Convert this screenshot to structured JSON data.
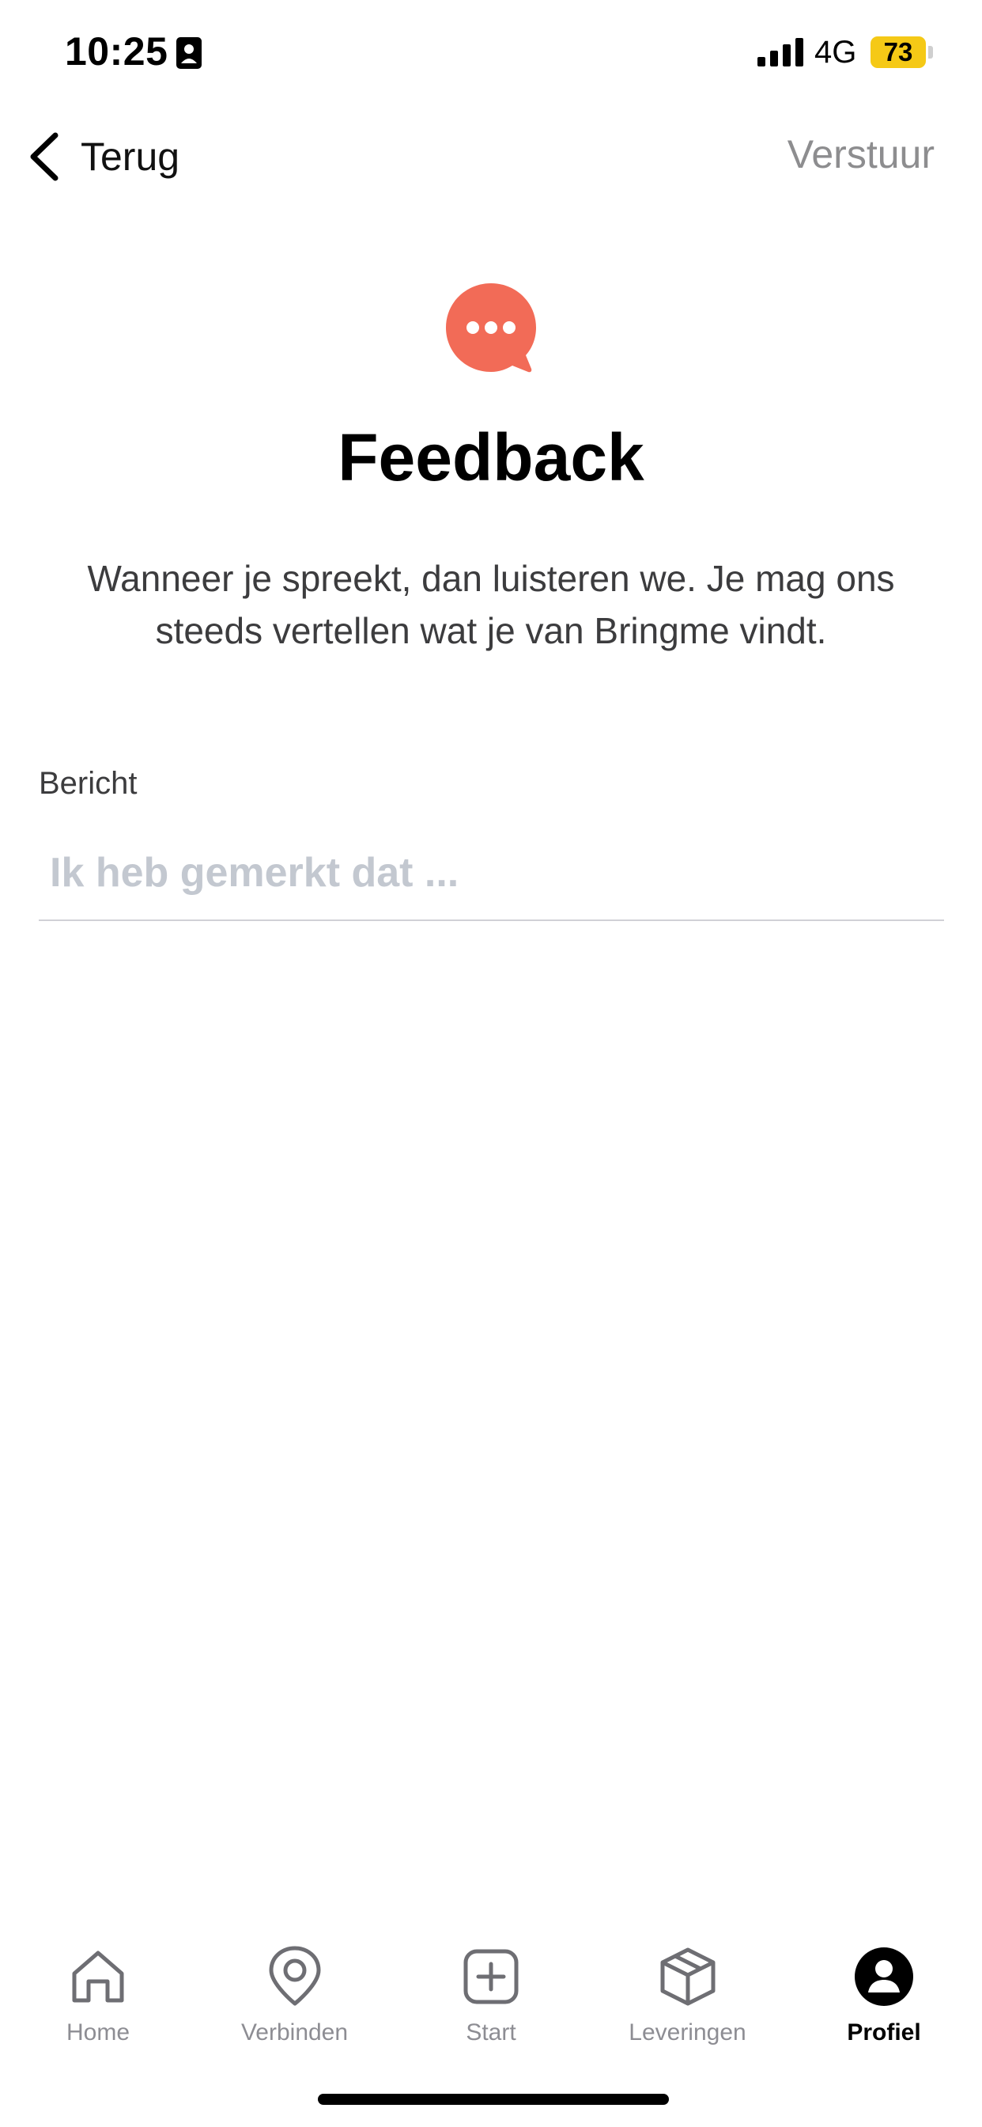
{
  "status_bar": {
    "time": "10:25",
    "network": "4G",
    "battery_level": "73",
    "battery_color": "#f5c916"
  },
  "nav": {
    "back_label": "Terug",
    "send_label": "Verstuur"
  },
  "header": {
    "icon": "chat-bubble-icon",
    "icon_color": "#f26b57",
    "title": "Feedback",
    "subtitle": "Wanneer je spreekt, dan luisteren we. Je mag ons steeds vertellen wat je van Bringme vindt."
  },
  "form": {
    "message_label": "Bericht",
    "message_value": "",
    "message_placeholder": "Ik heb gemerkt dat ..."
  },
  "tab_bar": {
    "active_tab": "Profiel",
    "tabs": [
      {
        "label": "Home",
        "icon": "home-icon"
      },
      {
        "label": "Verbinden",
        "icon": "location-pin-icon"
      },
      {
        "label": "Start",
        "icon": "plus-square-icon"
      },
      {
        "label": "Leveringen",
        "icon": "package-icon"
      },
      {
        "label": "Profiel",
        "icon": "profile-icon"
      }
    ]
  }
}
